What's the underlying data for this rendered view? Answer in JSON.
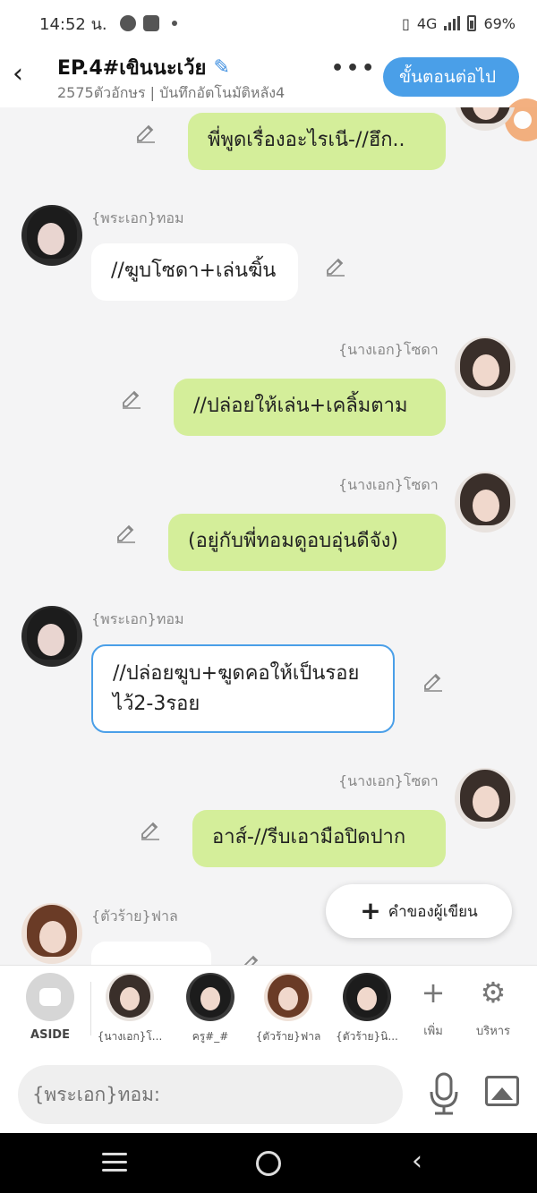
{
  "status_bar": {
    "time": "14:52 น.",
    "network": "4G",
    "battery": "69%"
  },
  "header": {
    "title": "EP.4#เขินนะเว้ย",
    "subtitle": "2575ตัวอักษร | บันทึกอัตโนมัติหลัง4",
    "next_label": "ขั้นตอนต่อไป"
  },
  "messages": [
    {
      "speaker": "",
      "side": "right",
      "text": "พี่พูดเรื่องอะไรเนี-//ฮึก..",
      "style": "green"
    },
    {
      "speaker": "{พระเอก}ทอม",
      "side": "left",
      "text": "//ฆูบโซดา+เล่นฆิ้น",
      "style": "white"
    },
    {
      "speaker": "{นางเอก}โซดา",
      "side": "right",
      "text": "//ปล่อยให้เล่น+เคลิ้มตาม",
      "style": "green"
    },
    {
      "speaker": "{นางเอก}โซดา",
      "side": "right",
      "text": "(อยู่กับพี่ทอมดูอบอุ่นดีจัง)",
      "style": "green"
    },
    {
      "speaker": "{พระเอก}ทอม",
      "side": "left",
      "text": "//ปล่อยฆูบ+ฆูดคอให้เป็นรอยไว้2-3รอย",
      "style": "selected"
    },
    {
      "speaker": "{นางเอก}โซดา",
      "side": "right",
      "text": "อาส์-//รีบเอามือปิดปาก",
      "style": "green"
    },
    {
      "speaker": "{ตัวร้าย}ฟาล",
      "side": "left",
      "text": "",
      "style": "white"
    }
  ],
  "author_note_label": "คำของผู้เขียน",
  "character_bar": {
    "aside_label": "ASIDE",
    "characters": [
      {
        "label": "{นางเอก}โ...",
        "avatar": "sodha"
      },
      {
        "label": "ครู#_#",
        "avatar": "teacher"
      },
      {
        "label": "{ตัวร้าย}ฟาล",
        "avatar": "farn"
      },
      {
        "label": "{ตัวร้าย}นิ...",
        "avatar": "villain"
      }
    ],
    "add_label": "เพิ่ม",
    "manage_label": "บริหาร"
  },
  "input": {
    "placeholder": "{พระเอก}ทอม:"
  },
  "colors": {
    "accent": "#4a9fe8",
    "bubble_green": "#d4ee9a"
  }
}
